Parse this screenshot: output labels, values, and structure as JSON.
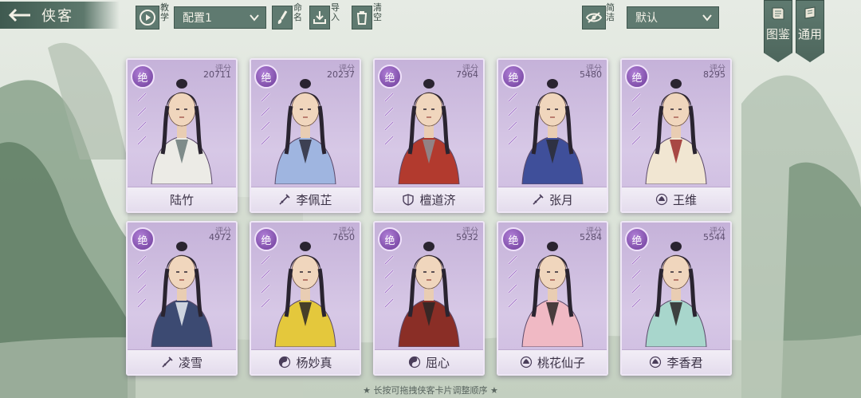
{
  "header": {
    "title": "侠客",
    "tutorial_label": "教学",
    "config_select": "配置1",
    "rename_label": "命名",
    "import_label": "导入",
    "clear_label": "清空",
    "simple_label": "简洁",
    "sort_select": "默认"
  },
  "side_tabs": [
    {
      "label": "图鉴",
      "icon": "book-icon"
    },
    {
      "label": "通用",
      "icon": "scroll-icon"
    }
  ],
  "cards": [
    {
      "name": "陆竹",
      "score_label": "评分",
      "score": "20711",
      "rank": "绝",
      "school_icon": "",
      "robe": "#ecebe6",
      "accent": "#6b7a78"
    },
    {
      "name": "李佩芷",
      "score_label": "评分",
      "score": "20237",
      "rank": "绝",
      "school_icon": "sword-icon",
      "robe": "#9fb5e0",
      "accent": "#2b2b3a"
    },
    {
      "name": "檀道济",
      "score_label": "评分",
      "score": "7964",
      "rank": "绝",
      "school_icon": "shield-icon",
      "robe": "#b23a2e",
      "accent": "#8c8f94"
    },
    {
      "name": "张月",
      "score_label": "评分",
      "score": "5480",
      "rank": "绝",
      "school_icon": "sword-icon",
      "robe": "#3f4f9a",
      "accent": "#2c2c34"
    },
    {
      "name": "王维",
      "score_label": "评分",
      "score": "8295",
      "rank": "绝",
      "school_icon": "lotus-icon",
      "robe": "#f1e6d2",
      "accent": "#9b2c2c"
    },
    {
      "name": "凌雪",
      "score_label": "评分",
      "score": "4972",
      "rank": "绝",
      "school_icon": "sword-icon",
      "robe": "#3c4a72",
      "accent": "#e8ecf2"
    },
    {
      "name": "杨妙真",
      "score_label": "评分",
      "score": "7650",
      "rank": "绝",
      "school_icon": "yinyang-icon",
      "robe": "#e4c83c",
      "accent": "#2a2626"
    },
    {
      "name": "屈心",
      "score_label": "评分",
      "score": "5932",
      "rank": "绝",
      "school_icon": "yinyang-icon",
      "robe": "#8a2e26",
      "accent": "#2a2626"
    },
    {
      "name": "桃花仙子",
      "score_label": "评分",
      "score": "5284",
      "rank": "绝",
      "school_icon": "lotus-icon",
      "robe": "#f0b9c4",
      "accent": "#2a2626"
    },
    {
      "name": "李香君",
      "score_label": "评分",
      "score": "5544",
      "rank": "绝",
      "school_icon": "lotus-icon",
      "robe": "#a8d6cc",
      "accent": "#2a2626"
    }
  ],
  "footer_hint": "★ 长按可拖拽侠客卡片调整顺序 ★"
}
